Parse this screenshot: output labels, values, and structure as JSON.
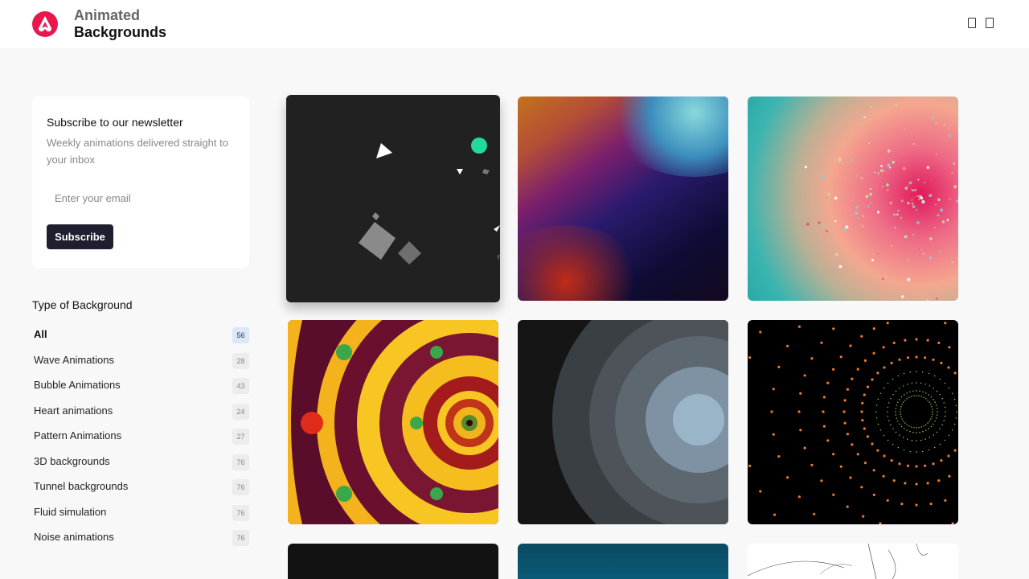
{
  "header": {
    "brand_line1": "Animated",
    "brand_line2": "Backgrounds",
    "logo_color": "#e8184f",
    "icons": [
      "window-icon",
      "window-icon"
    ]
  },
  "newsletter": {
    "title": "Subscribe to our newsletter",
    "description": "Weekly animations delivered straight to your inbox",
    "email_placeholder": "Enter your email",
    "subscribe_label": "Subscribe",
    "button_color": "#1f1f30"
  },
  "filters": {
    "title": "Type of Background",
    "items": [
      {
        "label": "All",
        "count": "56",
        "active": true
      },
      {
        "label": "Wave Animations",
        "count": "28"
      },
      {
        "label": "Bubble Animations",
        "count": "43"
      },
      {
        "label": "Heart animations",
        "count": "24"
      },
      {
        "label": "Pattern Animations",
        "count": "27"
      },
      {
        "label": "3D backgrounds",
        "count": "76"
      },
      {
        "label": "Tunnel backgrounds",
        "count": "76"
      },
      {
        "label": "Fluid simulation",
        "count": "76"
      },
      {
        "label": "Noise animations",
        "count": "76"
      }
    ]
  },
  "gallery": {
    "items": [
      {
        "id": "geometric-shapes"
      },
      {
        "id": "gradient-swirl"
      },
      {
        "id": "particle-gradient"
      },
      {
        "id": "kaleidoscope"
      },
      {
        "id": "concentric-circles"
      },
      {
        "id": "dot-tunnel"
      },
      {
        "id": "dark-tile"
      },
      {
        "id": "ocean-tile"
      },
      {
        "id": "line-sketch-tile"
      }
    ]
  }
}
